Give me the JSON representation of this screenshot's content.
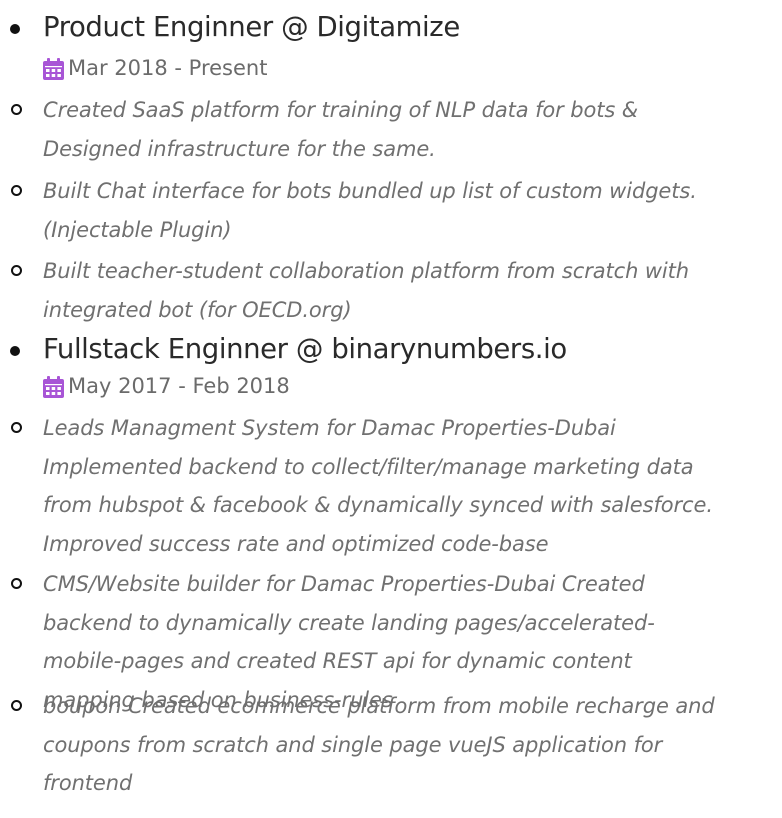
{
  "jobs": [
    {
      "title": "Product Enginner @ Digitamize",
      "date": "Mar 2018 - Present",
      "icon": "calendar-icon",
      "items": [
        [
          "Created SaaS platform for training of NLP data for bots &",
          "Designed infrastructure for the same."
        ],
        [
          "Built Chat interface for bots bundled up list of custom widgets.",
          "(Injectable Plugin)"
        ],
        [
          "Built teacher-student collaboration platform from scratch with",
          "integrated bot (for OECD.org)"
        ]
      ]
    },
    {
      "title": "Fullstack Enginner @ binarynumbers.io",
      "date": "May 2017 - Feb 2018",
      "icon": "calendar-icon",
      "items": [
        [
          "Leads Managment System for Damac Properties-Dubai",
          "Implemented backend to collect/filter/manage marketing data",
          "from hubspot & facebook & dynamically synced with salesforce.",
          "Improved success rate and optimized code-base"
        ],
        [
          "CMS/Website builder for Damac Properties-Dubai Created",
          "backend to dynamically create landing pages/accelerated-",
          "mobile-pages and created REST api for dynamic content",
          "mapping based on business-rules"
        ],
        [
          "boupon Created ecommerce platform from mobile recharge and",
          "coupons from scratch and single page vueJS application for",
          "frontend"
        ]
      ]
    }
  ],
  "colors": {
    "calendar": "#a855d6",
    "title": "#2a2a2a",
    "date": "#6b6b6b",
    "item_text": "#707070"
  }
}
